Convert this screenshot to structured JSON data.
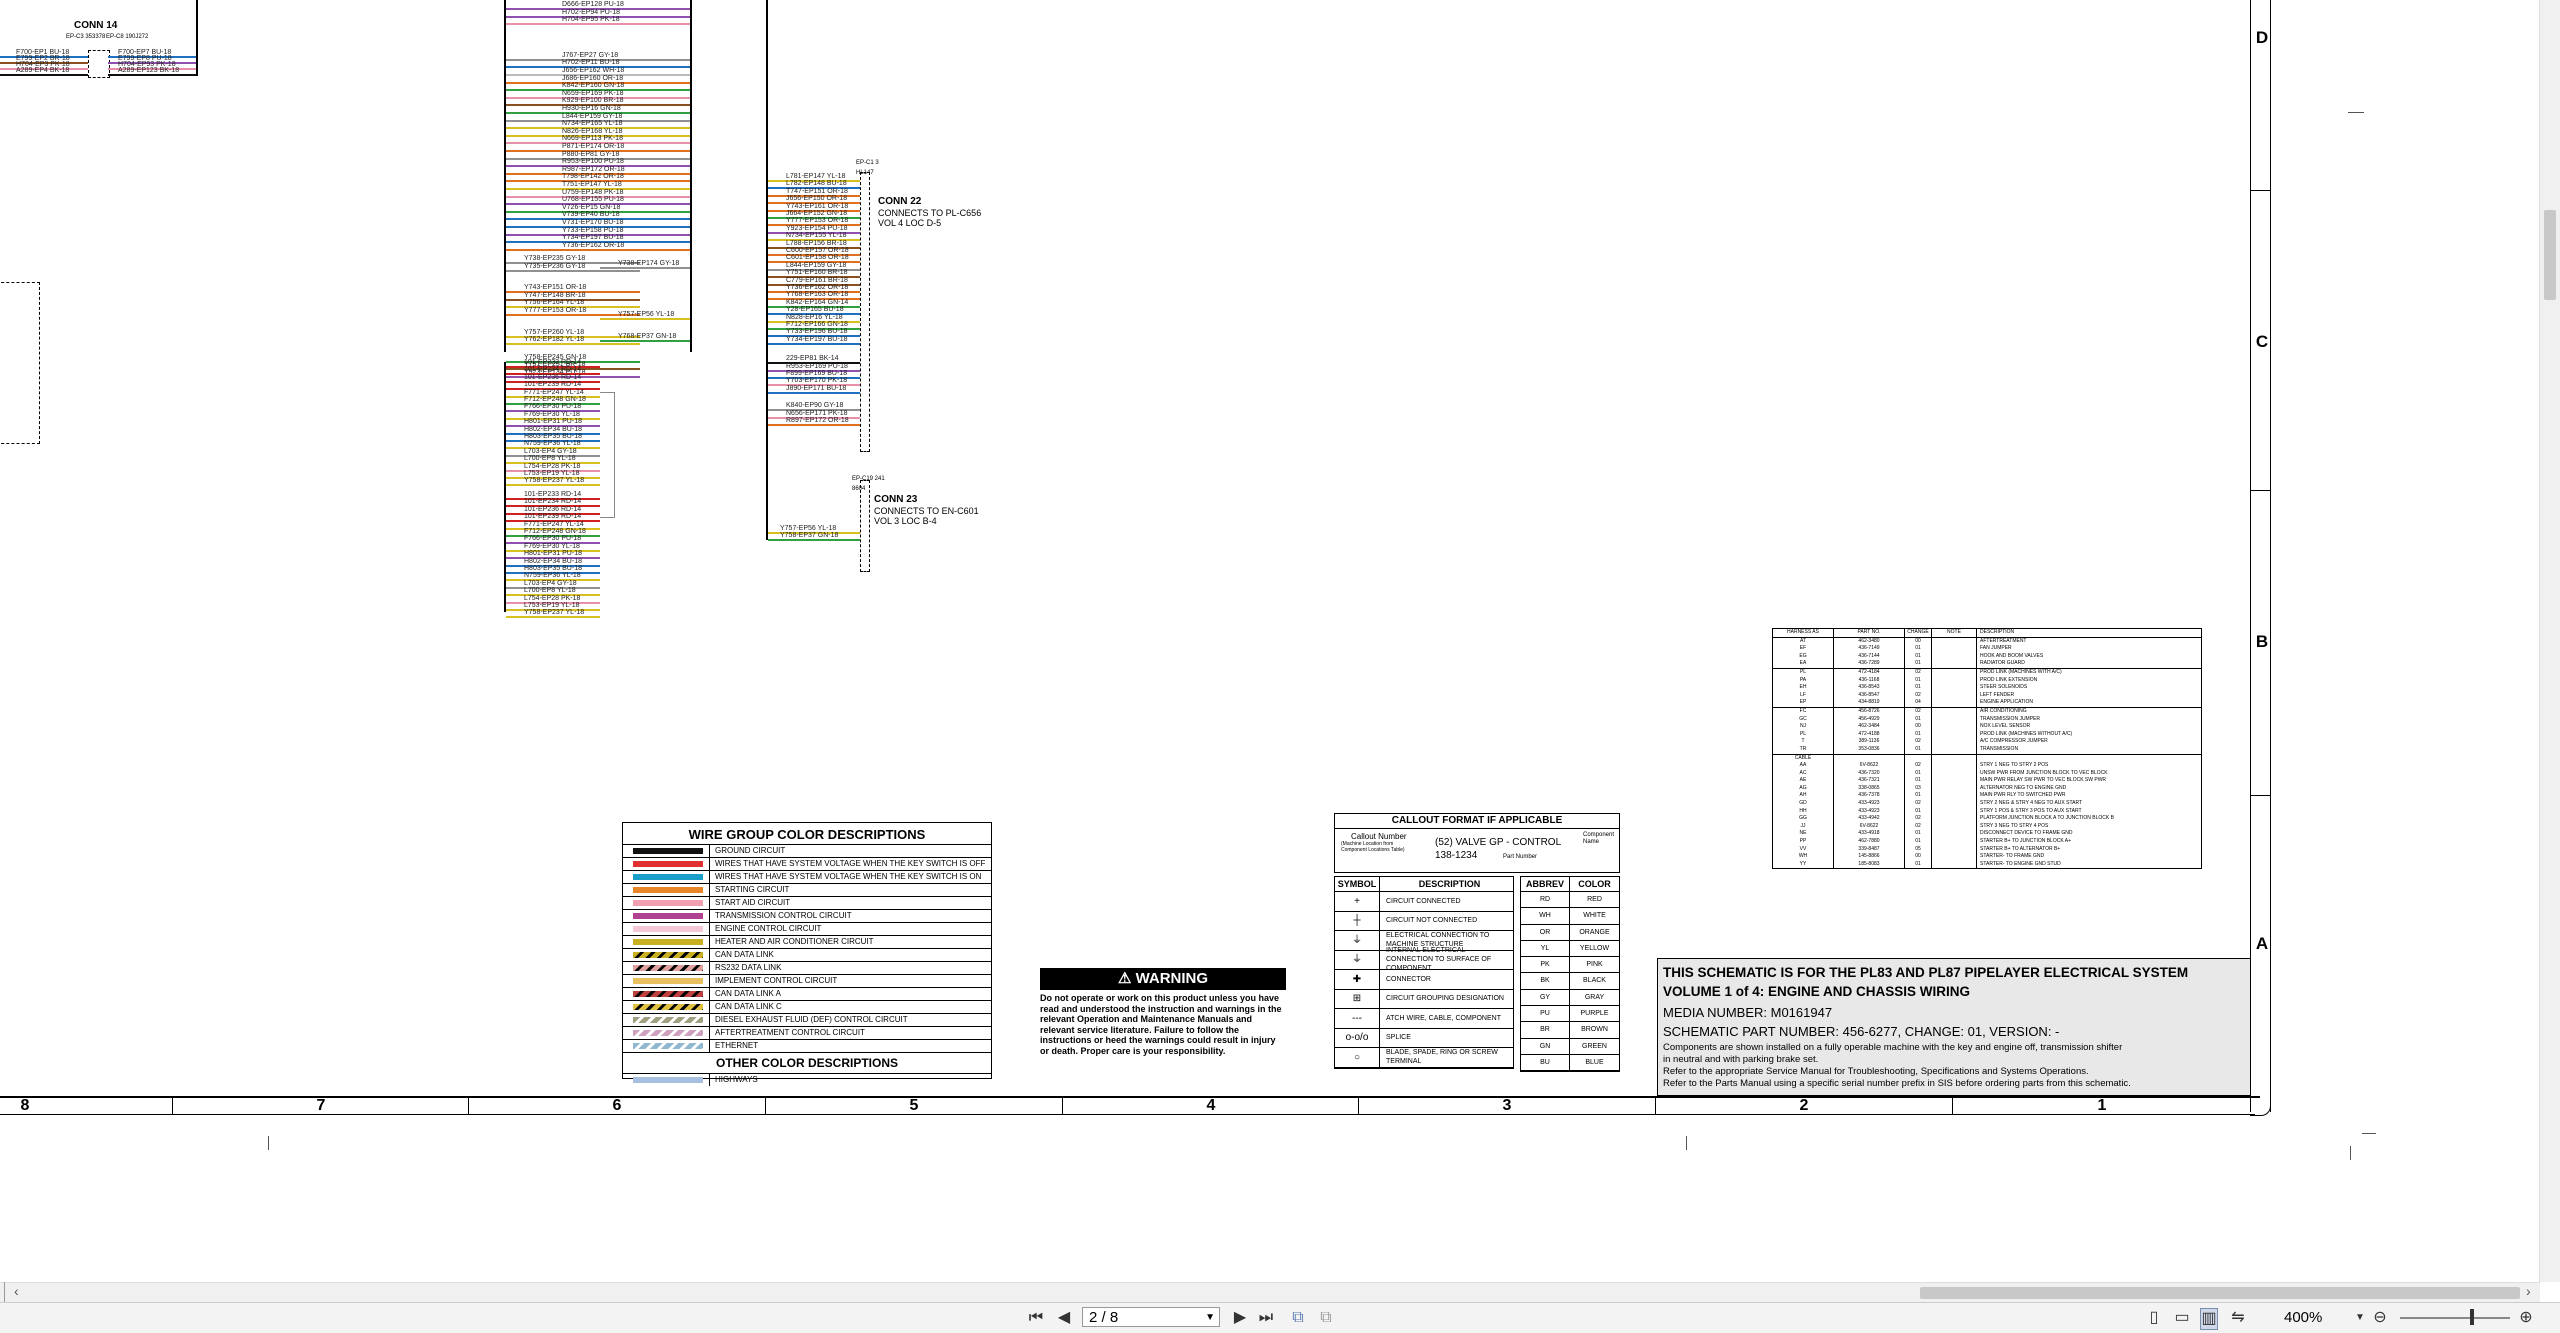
{
  "viewer": {
    "page_value": "2 / 8",
    "zoom": "400%",
    "buttons": [
      "first-page",
      "previous-page",
      "next-page",
      "last-page",
      "fit-page",
      "fit-width",
      "single-page-view",
      "continuous-view",
      "two-page-view",
      "rotate-view",
      "zoom-out",
      "zoom-in"
    ],
    "scroll_left_arrow": "‹",
    "scroll_right_arrow": "›"
  },
  "schematic": {
    "grid_columns": [
      "8",
      "7",
      "6",
      "5",
      "4",
      "3",
      "2",
      "1"
    ],
    "grid_rows": [
      "D",
      "C",
      "B",
      "A"
    ],
    "conn14": {
      "title": "CONN 14",
      "sub_left": "EP-C3 353378",
      "sub_right": "EP-C8 190J272",
      "wires_left": [
        "F700-EP1 BU-18",
        "E799-EP2 BR-18",
        "H704-EP3 PK-18",
        "A289-EP4 BK-18"
      ],
      "wires_right": [
        "F700-EP7 BU-18",
        "E799-EP8 PU-18",
        "H704-EP93 PK-18",
        "A289-EP123 BK-18"
      ]
    },
    "conn22": {
      "title": "CONN 22",
      "sub": "CONNECTS TO PL-C656",
      "sub2": "VOL 4 LOC D-5",
      "tag": "EP-C1 3 HL147"
    },
    "conn23": {
      "title": "CONN 23",
      "sub": "CONNECTS TO EN-C601",
      "sub2": "VOL 3 LOC B-4",
      "tag": "EP-C19 241 8604"
    },
    "harness_a_wires": [
      "D666-EP128 PU-18",
      "H702-EP94 PU-18",
      "H704-EP95 PK-18",
      "J767-EP27 GY-18",
      "H702-EP11 BU-18",
      "J656-EP162 WH-18",
      "J686-EP160 OR-18",
      "K842-EP160 GN-18",
      "N659-EP169 PK-18",
      "K929-EP100 BR-18",
      "H930-EP16 GN-18",
      "L844-EP159 GY-18",
      "N734-EP165 YL-18",
      "N826-EP168 YL-18",
      "N669-EP113 PK-18",
      "P871-EP174 OR-18",
      "P880-EP81 GY-18",
      "R953-EP100 PU-18",
      "R987-EP172 OR-18",
      "T798-EP142 OR-18",
      "T751-EP147 YL-18",
      "U759-EP148 PK-18",
      "U768-EP155 PU-18",
      "V726-EP15 GN-18",
      "V739-EP40 BU-18",
      "V731-EP170 BU-18",
      "Y733-EP158 PU-18",
      "Y734-EP197 BU-18",
      "Y736-EP162 OR-18"
    ],
    "harness_a_lower": [
      "Y738-EP235 GY-18",
      "Y735-EP236 GY-18",
      "Y743-EP151 OR-18",
      "Y747-EP148 BR-18",
      "Y756-EP164 YL-18",
      "Y777-EP153 OR-18",
      "Y757-EP260 YL-18",
      "Y762-EP182 YL-18",
      "Y758-EP245 GN-18",
      "Y751-EP251 BR-18",
      "Y923-EP134 PU-18"
    ],
    "harness_a_side": [
      "Y738-EP174 GY-18",
      "Y757-EP56 YL-18",
      "Y768-EP37 GN-18"
    ],
    "harness_b_wires": [
      "101-EP233 RD-14",
      "101-EP234 RD-14",
      "101-EP236 RD-14",
      "101-EP239 RD-14",
      "F771-EP247 YL-14",
      "F712-EP248 GN-18",
      "F766-EP30 PU-18",
      "F769-EP30 YL-18",
      "H801-EP31 PU-18",
      "H802-EP34 BU-18",
      "H803-EP35 BU-18",
      "N759-EP36 YL-18",
      "L703-EP4 GY-18",
      "L700-EP8 YL-18",
      "L754-EP28 PK-18",
      "L753-EP19 YL-18",
      "Y758-EP237 YL-18"
    ],
    "harness_c_wires": [
      "L781-EP147 YL-18",
      "L782-EP148 BU-18",
      "T747-EP151 OR-18",
      "J656-EP150 OR-18",
      "Y743-EP161 OR-18",
      "J664-EP152 GN-18",
      "Y777-EP153 OR-18",
      "Y923-EP154 PU-18",
      "N734-EP155 YL-18",
      "L788-EP156 BR-18",
      "C600-EP157 OR-18",
      "C601-EP158 OR-18",
      "L844-EP159 GY-18",
      "Y751-EP160 BR-18",
      "C779-EP161 BR-18",
      "Y736-EP162 OR-18",
      "Y768-EP163 OR-18",
      "K842-EP164 GN-14",
      "Y28-EP165 BU-18",
      "N828-EP16 YL-18",
      "F712-EP166 GN-18",
      "Y733-EP196 BU-18",
      "Y734-EP197 BU-18",
      "229-EP81 BK-14",
      "R953-EP169 PU-18",
      "F899-EP169 BU-18",
      "Y703-EP170 PK-18",
      "J890-EP171 BU-18",
      "K840-EP90 GY-18",
      "N656-EP171 PK-18",
      "R897-EP172 OR-18"
    ],
    "harness_c_bottom": [
      "Y757-EP56 YL-18",
      "Y758-EP37 GN-18"
    ],
    "legend": {
      "title": "WIRE GROUP COLOR DESCRIPTIONS",
      "rows": [
        {
          "label": "GROUND CIRCUIT",
          "color": "#111111",
          "pattern": "solid"
        },
        {
          "label": "WIRES THAT HAVE SYSTEM VOLTAGE WHEN THE KEY SWITCH IS OFF",
          "color": "#e03030",
          "pattern": "solid"
        },
        {
          "label": "WIRES THAT HAVE SYSTEM VOLTAGE WHEN THE KEY SWITCH IS ON",
          "color": "#1aa0c8",
          "pattern": "solid"
        },
        {
          "label": "STARTING CIRCUIT",
          "color": "#e8862a",
          "pattern": "solid"
        },
        {
          "label": "START AID CIRCUIT",
          "color": "#f0a0b0",
          "pattern": "solid"
        },
        {
          "label": "TRANSMISSION CONTROL CIRCUIT",
          "color": "#b04090",
          "pattern": "solid"
        },
        {
          "label": "ENGINE CONTROL CIRCUIT",
          "color": "#f4c8d8",
          "pattern": "solid"
        },
        {
          "label": "HEATER AND AIR CONDITIONER CIRCUIT",
          "color": "#c8b020",
          "pattern": "solid"
        },
        {
          "label": "CAN DATA LINK",
          "color": "#c8b020",
          "pattern": "stripe-black"
        },
        {
          "label": "RS232 DATA LINK",
          "color": "#e0a0a0",
          "pattern": "stripe-black"
        },
        {
          "label": "IMPLEMENT CONTROL CIRCUIT",
          "color": "#e8c060",
          "pattern": "solid"
        },
        {
          "label": "CAN DATA LINK A",
          "color": "#c04040",
          "pattern": "stripe-black"
        },
        {
          "label": "CAN DATA LINK C",
          "color": "#e0c040",
          "pattern": "stripe-black"
        },
        {
          "label": "DIESEL EXHAUST FLUID (DEF) CONTROL CIRCUIT",
          "color": "#a0a080",
          "pattern": "stripe-light"
        },
        {
          "label": "AFTERTREATMENT CONTROL CIRCUIT",
          "color": "#d0a0c0",
          "pattern": "stripe-light"
        },
        {
          "label": "ETHERNET",
          "color": "#90b8d0",
          "pattern": "stripe-light"
        }
      ],
      "other_title": "OTHER COLOR DESCRIPTIONS",
      "other_rows": [
        {
          "label": "HIGHWAYS",
          "color": "#a8c0e0",
          "pattern": "solid"
        }
      ]
    },
    "warning": {
      "title": "WARNING",
      "body": "Do not operate or work on this product unless you have read and understood the instruction and warnings in the relevant Operation and Maintenance Manuals and relevant service literature. Failure to follow the instructions or heed the warnings could result in injury or death. Proper care is your responsibility."
    },
    "callout": {
      "title": "CALLOUT FORMAT IF APPLICABLE",
      "callout_number": "Callout Number",
      "callout_number_sub": "(Machine Location from Component Locations Table)",
      "example": "(52) VALVE GP - CONTROL",
      "part": "138-1234",
      "component_name": "Component Name",
      "part_number": "Part Number"
    },
    "symbols": {
      "head_symbol": "SYMBOL",
      "head_desc": "DESCRIPTION",
      "rows": [
        {
          "sym": "+",
          "desc": "CIRCUIT CONNECTED"
        },
        {
          "sym": "┼",
          "desc": "CIRCUIT NOT CONNECTED"
        },
        {
          "sym": "⏚",
          "desc": "ELECTRICAL CONNECTION TO MACHINE STRUCTURE"
        },
        {
          "sym": "⏚",
          "desc": "INTERNAL ELECTRICAL CONNECTION TO SURFACE OF COMPONENT"
        },
        {
          "sym": "✚",
          "desc": "CONNECTOR"
        },
        {
          "sym": "⊞",
          "desc": "CIRCUIT GROUPING DESIGNATION"
        },
        {
          "sym": "---",
          "desc": "ATCH WIRE, CABLE, COMPONENT"
        },
        {
          "sym": "o-o/o",
          "desc": "SPLICE"
        },
        {
          "sym": "○",
          "desc": "BLADE, SPADE, RING OR SCREW TERMINAL"
        }
      ]
    },
    "abbrevs": {
      "head_abbrev": "ABBREV",
      "head_color": "COLOR",
      "rows": [
        [
          "RD",
          "RED"
        ],
        [
          "WH",
          "WHITE"
        ],
        [
          "OR",
          "ORANGE"
        ],
        [
          "YL",
          "YELLOW"
        ],
        [
          "PK",
          "PINK"
        ],
        [
          "BK",
          "BLACK"
        ],
        [
          "GY",
          "GRAY"
        ],
        [
          "PU",
          "PURPLE"
        ],
        [
          "BR",
          "BROWN"
        ],
        [
          "GN",
          "GREEN"
        ],
        [
          "BU",
          "BLUE"
        ]
      ]
    },
    "info": {
      "line1": "THIS SCHEMATIC IS FOR THE PL83 AND PL87 PIPELAYER ELECTRICAL SYSTEM",
      "line2": "VOLUME 1 of 4: ENGINE AND CHASSIS WIRING",
      "line3": "MEDIA NUMBER: M0161947",
      "line4": "SCHEMATIC PART NUMBER: 456-6277, CHANGE: 01, VERSION: -",
      "line5": "Components are shown installed on a fully operable machine with the key and engine off, transmission shifter",
      "line6": "in neutral and with parking brake set.",
      "line7": "Refer to the appropriate Service Manual for Troubleshooting, Specifications and Systems Operations.",
      "line8": "Refer to the Parts Manual using a specific serial number prefix in SIS before ordering parts from this schematic."
    },
    "reftable": {
      "headers": [
        "HARNESS AS",
        "PART NO.",
        "CHANGE",
        "NOTE",
        "DESCRIPTION"
      ],
      "rows": [
        [
          "AT",
          "462-3480",
          "00",
          "",
          "AFTERTREATMENT"
        ],
        [
          "EF",
          "436-7149",
          "01",
          "",
          "FAN JUMPER"
        ],
        [
          "EG",
          "436-7144",
          "01",
          "",
          "HOOK AND BOOM VALVES"
        ],
        [
          "EA",
          "436-7289",
          "01",
          "",
          "RADIATOR GUARD"
        ],
        [
          "PL",
          "472-4184",
          "02",
          "",
          "PROD LINK (MACHINES WITH A/C)"
        ],
        [
          "PA",
          "436-1168",
          "01",
          "",
          "PROD LINK EXTENSION"
        ],
        [
          "EH",
          "436-8543",
          "01",
          "",
          "STEER SOLENOIDS"
        ],
        [
          "LF",
          "436-8547",
          "02",
          "",
          "LEFT FENDER"
        ],
        [
          "EP",
          "434-8819",
          "04",
          "",
          "ENGINE APPLICATION"
        ],
        [
          "FC",
          "456-8726",
          "02",
          "",
          "AIR CONDITIONING"
        ],
        [
          "GC",
          "456-4929",
          "01",
          "",
          "TRANSMISSION JUMPER"
        ],
        [
          "NJ",
          "462-3484",
          "00",
          "",
          "NOX LEVEL SENSOR"
        ],
        [
          "PL",
          "472-4188",
          "01",
          "",
          "PROD LINK (MACHINES WITHOUT A/C)"
        ],
        [
          "T",
          "389-1136",
          "02",
          "",
          "A/C COMPRESSOR JUMPER"
        ],
        [
          "TR",
          "353-0836",
          "01",
          "",
          "TRANSMISSION"
        ],
        [
          "CABLE",
          "",
          "",
          "",
          ""
        ],
        [
          "AA",
          "6V-8622",
          "02",
          "",
          "STRY 1 NEG TO STRY 2 POS"
        ],
        [
          "AC",
          "436-7320",
          "01",
          "",
          "UNSW PWR FROM JUNCTION BLOCK TO VEC BLOCK"
        ],
        [
          "AE",
          "436-7321",
          "01",
          "",
          "MAIN PWR RELAY SW PWR TO VEC BLOCK SW PWR"
        ],
        [
          "AG",
          "338-0865",
          "03",
          "",
          "ALTERNATOR NEG TO ENGINE GND"
        ],
        [
          "AH",
          "436-7378",
          "01",
          "",
          "MAIN PWR RLY TO SWITCHED PWR"
        ],
        [
          "GD",
          "433-4923",
          "02",
          "",
          "STRY 2 NEG & STRY 4 NEG TO AUX START"
        ],
        [
          "HH",
          "433-4923",
          "01",
          "",
          "STRY 1 POS & STRY 3 POS TO AUX START"
        ],
        [
          "GG",
          "433-4942",
          "02",
          "",
          "PLATFORM JUNCTION BLOCK A TO JUNCTION BLOCK B"
        ],
        [
          "JJ",
          "6V-8622",
          "02",
          "",
          "STRY 3 NEG TO STRY 4 POS"
        ],
        [
          "NE",
          "433-4918",
          "01",
          "",
          "DISCONNECT DEVICE TO FRAME GND"
        ],
        [
          "PP",
          "462-7880",
          "01",
          "",
          "STARTER B+ TO JUNCTION BLOCK A+"
        ],
        [
          "VV",
          "339-8487",
          "05",
          "",
          "STARTER B+ TO ALTERNATOR B+"
        ],
        [
          "WH",
          "145-8866",
          "00",
          "",
          "STARTER- TO FRAME GND"
        ],
        [
          "YY",
          "185-8083",
          "01",
          "",
          "STARTER- TO ENGINE GND STUD"
        ]
      ]
    }
  },
  "colors": {
    "ground": "#111111",
    "unsw": "#e03030",
    "sw": "#1aa0c8",
    "start": "#e8862a",
    "pink": "#f0a0b0",
    "purple": "#b04090",
    "yellow": "#c8b020"
  }
}
